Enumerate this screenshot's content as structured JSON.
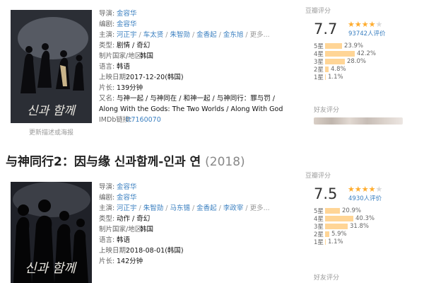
{
  "movies": [
    {
      "poster_caption": "更新描述或海报",
      "info": {
        "director_label": "导演:",
        "director": "金容华",
        "writer_label": "编剧:",
        "writer": "金容华",
        "cast_label": "主演:",
        "cast": [
          "河正宇",
          "车太贤",
          "朱智勋",
          "金香起",
          "金东旭"
        ],
        "cast_more": "更多...",
        "genre_label": "类型:",
        "genre": "剧情 / 奇幻",
        "country_label": "制片国家/地区:",
        "country": "韩国",
        "language_label": "语言:",
        "language": "韩语",
        "release_label": "上映日期:",
        "release": "2017-12-20(韩国)",
        "runtime_label": "片长:",
        "runtime": "139分钟",
        "aka_label": "又名:",
        "aka_line1": "与神一起 / 与神同在 / 和神一起 / 与神同行：罪与罚 /",
        "aka_line2": "Along With the Gods: The Two Worlds / Along With God",
        "imdb_label": "IMDb链接:",
        "imdb": "tt7160070"
      },
      "rating": {
        "title": "豆瓣评分",
        "score": "7.7",
        "stars_filled": 4,
        "count": "93742人评价",
        "distribution": [
          {
            "label": "5星",
            "percent": 23.9,
            "text": "23.9%"
          },
          {
            "label": "4星",
            "percent": 42.2,
            "text": "42.2%"
          },
          {
            "label": "3星",
            "percent": 28.0,
            "text": "28.0%"
          },
          {
            "label": "2星",
            "percent": 4.8,
            "text": "4.8%"
          },
          {
            "label": "1星",
            "percent": 1.1,
            "text": "1.1%"
          }
        ],
        "friend_title": "好友评分"
      }
    },
    {
      "title_cn": "与神同行2：因与缘 신과함께-인과 연",
      "year": "(2018)",
      "info": {
        "director_label": "导演:",
        "director": "金容华",
        "writer_label": "编剧:",
        "writer": "金容华",
        "cast_label": "主演:",
        "cast": [
          "河正宇",
          "朱智勋",
          "马东锡",
          "金香起",
          "李政宰"
        ],
        "cast_more": "更多...",
        "genre_label": "类型:",
        "genre": "动作 / 奇幻",
        "country_label": "制片国家/地区:",
        "country": "韩国",
        "language_label": "语言:",
        "language": "韩语",
        "release_label": "上映日期:",
        "release": "2018-08-01(韩国)",
        "runtime_label": "片长:",
        "runtime": "142分钟"
      },
      "rating": {
        "title": "豆瓣评分",
        "score": "7.5",
        "stars_filled": 4,
        "count": "4930人评价",
        "distribution": [
          {
            "label": "5星",
            "percent": 20.9,
            "text": "20.9%"
          },
          {
            "label": "4星",
            "percent": 40.3,
            "text": "40.3%"
          },
          {
            "label": "3星",
            "percent": 31.8,
            "text": "31.8%"
          },
          {
            "label": "2星",
            "percent": 5.9,
            "text": "5.9%"
          },
          {
            "label": "1星",
            "percent": 1.1,
            "text": "1.1%"
          }
        ],
        "friend_title": "好友评分"
      }
    }
  ],
  "colors": {
    "link": "#3a7fc0",
    "star": "#ffac2d",
    "bar": "#ffd596"
  }
}
